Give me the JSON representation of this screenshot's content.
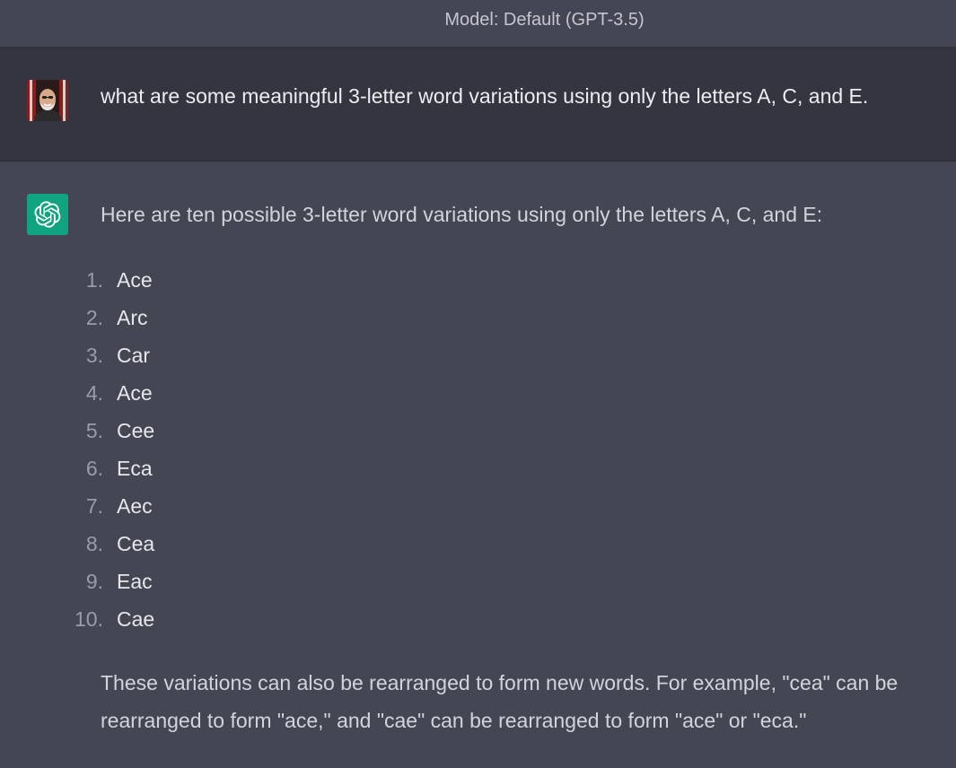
{
  "header": {
    "model_label": "Model: Default (GPT-3.5)"
  },
  "user_message": {
    "avatar_icon": "user-avatar",
    "text": "what are some meaningful 3-letter word variations using only the letters A, C, and E."
  },
  "assistant_message": {
    "icon": "openai-logo-icon",
    "intro": "Here are ten possible 3-letter word variations using only the letters A, C, and E:",
    "items": [
      {
        "num": "1.",
        "word": "Ace"
      },
      {
        "num": "2.",
        "word": "Arc"
      },
      {
        "num": "3.",
        "word": "Car"
      },
      {
        "num": "4.",
        "word": "Ace"
      },
      {
        "num": "5.",
        "word": "Cee"
      },
      {
        "num": "6.",
        "word": "Eca"
      },
      {
        "num": "7.",
        "word": "Aec"
      },
      {
        "num": "8.",
        "word": "Cea"
      },
      {
        "num": "9.",
        "word": "Eac"
      },
      {
        "num": "10.",
        "word": "Cae"
      }
    ],
    "outro": "These variations can also be rearranged to form new words. For example, \"cea\" can be rearranged to form \"ace,\" and \"cae\" can be rearranged to form \"ace\" or \"eca.\""
  },
  "colors": {
    "assistant_bg": "#444654",
    "user_bg": "#343541",
    "gpt_icon_bg": "#10a37f"
  }
}
